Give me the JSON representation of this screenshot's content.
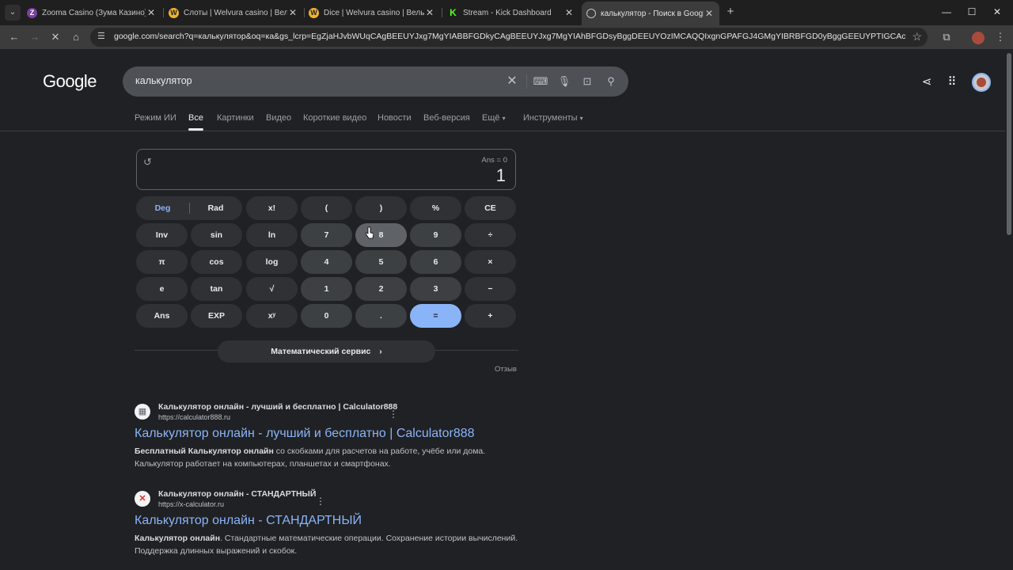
{
  "browser": {
    "tabs": [
      {
        "label": "Zooma Casino (Зума Казино) о",
        "close": "✕"
      },
      {
        "label": "Слоты | Welvura casino | Вельв",
        "close": "✕"
      },
      {
        "label": "Dice | Welvura casino | Вельвур",
        "close": "✕"
      },
      {
        "label": "Stream - Kick Dashboard",
        "close": "✕"
      },
      {
        "label": "калькулятор - Поиск в Google",
        "close": "✕"
      }
    ],
    "url": "google.com/search?q=калькулятор&oq=ка&gs_lcrp=EgZjaHJvbWUqCAgBEEUYJxg7MgYIABBFGDkyCAgBEEUYJxg7MgYIAhBFGDsyBggDEEUYOzIMCAQQIxgnGPAFGJ4GMgYIBRBFGD0yBggGEEUYPTIGCAcQRRg90gEM..."
  },
  "google": {
    "logo": "Google",
    "query": "калькулятор",
    "nav": [
      "Режим ИИ",
      "Все",
      "Картинки",
      "Видео",
      "Короткие видео",
      "Новости",
      "Веб-версия",
      "Ещё",
      "Инструменты"
    ],
    "nav_active_index": 1
  },
  "calculator": {
    "ans_label": "Ans = 0",
    "display": "1",
    "keys": {
      "deg": "Deg",
      "rad": "Rad",
      "fact": "x!",
      "lparen": "(",
      "rparen": ")",
      "percent": "%",
      "ce": "CE",
      "inv": "Inv",
      "sin": "sin",
      "ln": "ln",
      "k7": "7",
      "k8": "8",
      "k9": "9",
      "div": "÷",
      "pi": "π",
      "cos": "cos",
      "log": "log",
      "k4": "4",
      "k5": "5",
      "k6": "6",
      "mul": "×",
      "e": "e",
      "tan": "tan",
      "sqrt": "√",
      "k1": "1",
      "k2": "2",
      "k3": "3",
      "minus": "−",
      "ans": "Ans",
      "exp": "EXP",
      "pow": "xʸ",
      "k0": "0",
      "dot": ".",
      "eq": "=",
      "plus": "+"
    },
    "math_service": "Математический сервис",
    "feedback": "Отзыв"
  },
  "results": [
    {
      "site": "Калькулятор онлайн - лучший и бесплатно | Calculator888",
      "url": "https://calculator888.ru",
      "title": "Калькулятор онлайн - лучший и бесплатно | Calculator888",
      "snippet_bold": "Бесплатный Калькулятор онлайн",
      "snippet_rest": " со скобками для расчетов на работе, учёбе или дома. Калькулятор работает на компьютерах, планшетах и смартфонах."
    },
    {
      "site": "Калькулятор онлайн - СТАНДАРТНЫЙ",
      "url": "https://x-calculator.ru",
      "title": "Калькулятор онлайн - СТАНДАРТНЫЙ",
      "snippet_bold": "Калькулятор онлайн",
      "snippet_rest": ". Стандартные математические операции. Сохранение истории вычислений. Поддержка длинных выражений и скобок."
    }
  ]
}
